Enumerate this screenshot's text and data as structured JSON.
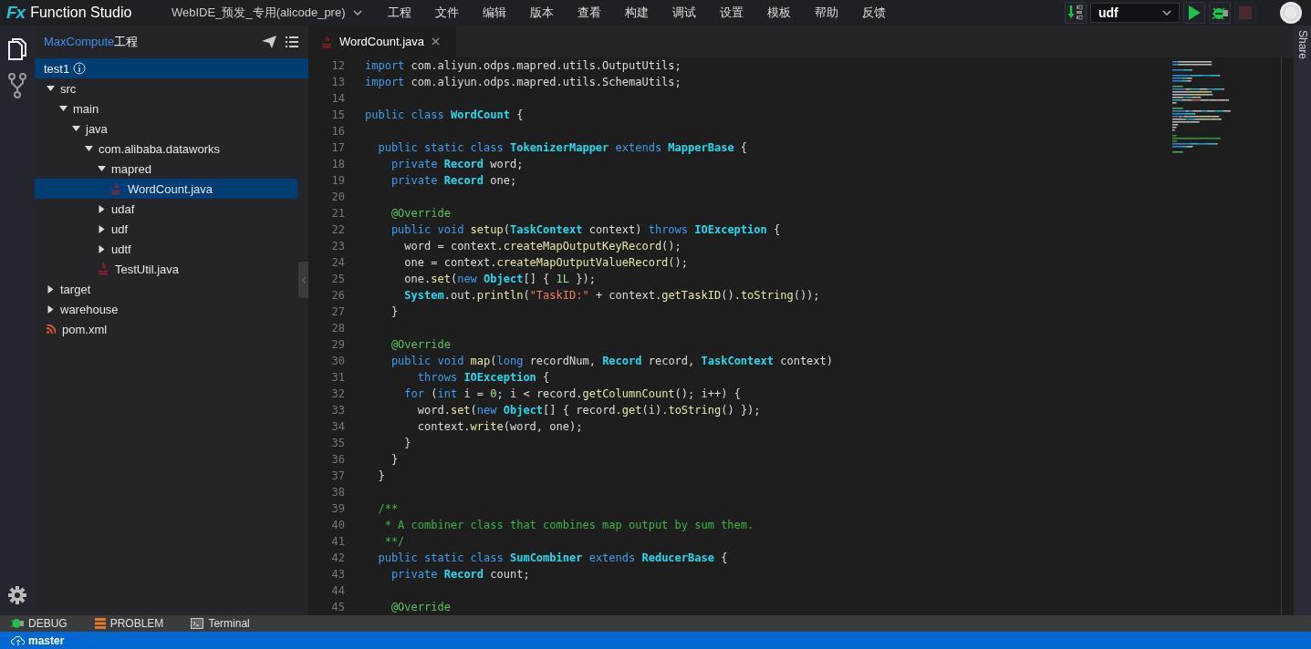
{
  "app": {
    "logo": "Fx",
    "name": "Function Studio",
    "workspace": "WebIDE_预发_专用(alicode_pre)"
  },
  "menu": [
    "工程",
    "文件",
    "编辑",
    "版本",
    "查看",
    "构建",
    "调试",
    "设置",
    "模板",
    "帮助",
    "反馈"
  ],
  "toolbar": {
    "target": "udf",
    "stop_disabled": true
  },
  "sidebar": {
    "title": {
      "brand": "MaxCompute",
      "rest": "工程"
    },
    "project": {
      "name": "test1",
      "selected": true
    },
    "tree": [
      {
        "name": "src",
        "kind": "folder",
        "expanded": true,
        "selected": false,
        "children": [
          {
            "name": "main",
            "kind": "folder",
            "expanded": true,
            "selected": false,
            "children": [
              {
                "name": "java",
                "kind": "folder",
                "expanded": true,
                "selected": false,
                "children": [
                  {
                    "name": "com.alibaba.dataworks",
                    "kind": "folder",
                    "expanded": true,
                    "selected": false,
                    "children": [
                      {
                        "name": "mapred",
                        "kind": "folder",
                        "expanded": true,
                        "selected": false,
                        "children": [
                          {
                            "name": "WordCount.java",
                            "kind": "java",
                            "selected": true
                          }
                        ]
                      },
                      {
                        "name": "udaf",
                        "kind": "folder",
                        "expanded": false,
                        "selected": false
                      },
                      {
                        "name": "udf",
                        "kind": "folder",
                        "expanded": false,
                        "selected": false
                      },
                      {
                        "name": "udtf",
                        "kind": "folder",
                        "expanded": false,
                        "selected": false
                      },
                      {
                        "name": "TestUtil.java",
                        "kind": "java",
                        "selected": false
                      }
                    ]
                  }
                ]
              }
            ]
          }
        ]
      },
      {
        "name": "target",
        "kind": "folder",
        "expanded": false,
        "selected": false
      },
      {
        "name": "warehouse",
        "kind": "folder",
        "expanded": false,
        "selected": false
      },
      {
        "name": "pom.xml",
        "kind": "xml",
        "selected": false
      }
    ]
  },
  "tabs": [
    {
      "label": "WordCount.java",
      "selected": true
    }
  ],
  "code": [
    {
      "no": "12",
      "tokens": [
        {
          "kind": "keyword",
          "text": "import "
        },
        {
          "kind": "plain",
          "text": "com.aliyun.odps.mapred.utils.OutputUtils;"
        }
      ]
    },
    {
      "no": "13",
      "tokens": [
        {
          "kind": "keyword",
          "text": "import "
        },
        {
          "kind": "plain",
          "text": "com.aliyun.odps.mapred.utils.SchemaUtils;"
        }
      ]
    },
    {
      "no": "14"
    },
    {
      "no": "15",
      "tokens": [
        {
          "kind": "keyword",
          "text": "public class "
        },
        {
          "kind": "type",
          "text": "WordCount"
        },
        {
          "kind": "plain",
          "text": " {"
        }
      ]
    },
    {
      "no": "16"
    },
    {
      "no": "17",
      "tokens": [
        {
          "kind": "keyword",
          "text": "  public static class "
        },
        {
          "kind": "type",
          "text": "TokenizerMapper"
        },
        {
          "kind": "keyword",
          "text": " extends "
        },
        {
          "kind": "type",
          "text": "MapperBase"
        },
        {
          "kind": "plain",
          "text": " {"
        }
      ]
    },
    {
      "no": "18",
      "tokens": [
        {
          "kind": "keyword",
          "text": "    private "
        },
        {
          "kind": "type",
          "text": "Record"
        },
        {
          "kind": "plain",
          "text": " word;"
        }
      ]
    },
    {
      "no": "19",
      "tokens": [
        {
          "kind": "keyword",
          "text": "    private "
        },
        {
          "kind": "type",
          "text": "Record"
        },
        {
          "kind": "plain",
          "text": " one;"
        }
      ]
    },
    {
      "no": "20"
    },
    {
      "no": "21",
      "tokens": [
        {
          "kind": "annotation",
          "text": "    @Override"
        }
      ]
    },
    {
      "no": "22",
      "tokens": [
        {
          "kind": "keyword",
          "text": "    public void "
        },
        {
          "kind": "method",
          "text": "setup"
        },
        {
          "kind": "plain",
          "text": "("
        },
        {
          "kind": "type",
          "text": "TaskContext"
        },
        {
          "kind": "plain",
          "text": " context) "
        },
        {
          "kind": "keyword",
          "text": "throws "
        },
        {
          "kind": "type",
          "text": "IOException"
        },
        {
          "kind": "plain",
          "text": " {"
        }
      ]
    },
    {
      "no": "23",
      "tokens": [
        {
          "kind": "plain",
          "text": "      word = context."
        },
        {
          "kind": "method",
          "text": "createMapOutputKeyRecord"
        },
        {
          "kind": "plain",
          "text": "();"
        }
      ]
    },
    {
      "no": "24",
      "tokens": [
        {
          "kind": "plain",
          "text": "      one = context."
        },
        {
          "kind": "method",
          "text": "createMapOutputValueRecord"
        },
        {
          "kind": "plain",
          "text": "();"
        }
      ]
    },
    {
      "no": "25",
      "tokens": [
        {
          "kind": "plain",
          "text": "      one."
        },
        {
          "kind": "method",
          "text": "set"
        },
        {
          "kind": "plain",
          "text": "("
        },
        {
          "kind": "keyword",
          "text": "new "
        },
        {
          "kind": "type",
          "text": "Object"
        },
        {
          "kind": "plain",
          "text": "[] { "
        },
        {
          "kind": "number",
          "text": "1L"
        },
        {
          "kind": "plain",
          "text": " });"
        }
      ]
    },
    {
      "no": "26",
      "tokens": [
        {
          "kind": "type",
          "text": "      System"
        },
        {
          "kind": "plain",
          "text": ".out."
        },
        {
          "kind": "method",
          "text": "println"
        },
        {
          "kind": "plain",
          "text": "("
        },
        {
          "kind": "string",
          "text": "\"TaskID:\""
        },
        {
          "kind": "plain",
          "text": " + context."
        },
        {
          "kind": "method",
          "text": "getTaskID"
        },
        {
          "kind": "plain",
          "text": "()."
        },
        {
          "kind": "method",
          "text": "toString"
        },
        {
          "kind": "plain",
          "text": "());"
        }
      ]
    },
    {
      "no": "27",
      "tokens": [
        {
          "kind": "plain",
          "text": "    }"
        }
      ]
    },
    {
      "no": "28"
    },
    {
      "no": "29",
      "tokens": [
        {
          "kind": "annotation",
          "text": "    @Override"
        }
      ]
    },
    {
      "no": "30",
      "tokens": [
        {
          "kind": "keyword",
          "text": "    public void "
        },
        {
          "kind": "method",
          "text": "map"
        },
        {
          "kind": "plain",
          "text": "("
        },
        {
          "kind": "keyword",
          "text": "long"
        },
        {
          "kind": "plain",
          "text": " recordNum, "
        },
        {
          "kind": "type",
          "text": "Record"
        },
        {
          "kind": "plain",
          "text": " record, "
        },
        {
          "kind": "type",
          "text": "TaskContext"
        },
        {
          "kind": "plain",
          "text": " context)"
        }
      ]
    },
    {
      "no": "31",
      "tokens": [
        {
          "kind": "keyword",
          "text": "        throws "
        },
        {
          "kind": "type",
          "text": "IOException"
        },
        {
          "kind": "plain",
          "text": " {"
        }
      ]
    },
    {
      "no": "32",
      "tokens": [
        {
          "kind": "keyword",
          "text": "      for"
        },
        {
          "kind": "plain",
          "text": " ("
        },
        {
          "kind": "keyword",
          "text": "int"
        },
        {
          "kind": "plain",
          "text": " i = "
        },
        {
          "kind": "number",
          "text": "0"
        },
        {
          "kind": "plain",
          "text": "; i < record."
        },
        {
          "kind": "method",
          "text": "getColumnCount"
        },
        {
          "kind": "plain",
          "text": "(); i++) {"
        }
      ]
    },
    {
      "no": "33",
      "tokens": [
        {
          "kind": "plain",
          "text": "        word."
        },
        {
          "kind": "method",
          "text": "set"
        },
        {
          "kind": "plain",
          "text": "("
        },
        {
          "kind": "keyword",
          "text": "new "
        },
        {
          "kind": "type",
          "text": "Object"
        },
        {
          "kind": "plain",
          "text": "[] { record."
        },
        {
          "kind": "method",
          "text": "get"
        },
        {
          "kind": "plain",
          "text": "(i)."
        },
        {
          "kind": "method",
          "text": "toString"
        },
        {
          "kind": "plain",
          "text": "() });"
        }
      ]
    },
    {
      "no": "34",
      "tokens": [
        {
          "kind": "plain",
          "text": "        context."
        },
        {
          "kind": "method",
          "text": "write"
        },
        {
          "kind": "plain",
          "text": "(word, one);"
        }
      ]
    },
    {
      "no": "35",
      "tokens": [
        {
          "kind": "plain",
          "text": "      }"
        }
      ]
    },
    {
      "no": "36",
      "tokens": [
        {
          "kind": "plain",
          "text": "    }"
        }
      ]
    },
    {
      "no": "37",
      "tokens": [
        {
          "kind": "plain",
          "text": "  }"
        }
      ]
    },
    {
      "no": "38"
    },
    {
      "no": "39",
      "tokens": [
        {
          "kind": "comment",
          "text": "  /**"
        }
      ]
    },
    {
      "no": "40",
      "tokens": [
        {
          "kind": "comment",
          "text": "   * A combiner class that combines map output by sum them."
        }
      ]
    },
    {
      "no": "41",
      "tokens": [
        {
          "kind": "comment",
          "text": "   **/"
        }
      ]
    },
    {
      "no": "42",
      "tokens": [
        {
          "kind": "keyword",
          "text": "  public static class "
        },
        {
          "kind": "type",
          "text": "SumCombiner"
        },
        {
          "kind": "keyword",
          "text": " extends "
        },
        {
          "kind": "type",
          "text": "ReducerBase"
        },
        {
          "kind": "plain",
          "text": " {"
        }
      ]
    },
    {
      "no": "43",
      "tokens": [
        {
          "kind": "keyword",
          "text": "    private "
        },
        {
          "kind": "type",
          "text": "Record"
        },
        {
          "kind": "plain",
          "text": " count;"
        }
      ]
    },
    {
      "no": "44"
    },
    {
      "no": "45",
      "tokens": [
        {
          "kind": "annotation",
          "text": "    @Override"
        }
      ]
    }
  ],
  "right_panel": {
    "label": "Share"
  },
  "panel_tabs": [
    {
      "label": "DEBUG",
      "kind": "debug"
    },
    {
      "label": "PROBLEM",
      "kind": "problem"
    },
    {
      "label": "Terminal",
      "kind": "terminal"
    }
  ],
  "status_bar": {
    "branch": "master"
  }
}
